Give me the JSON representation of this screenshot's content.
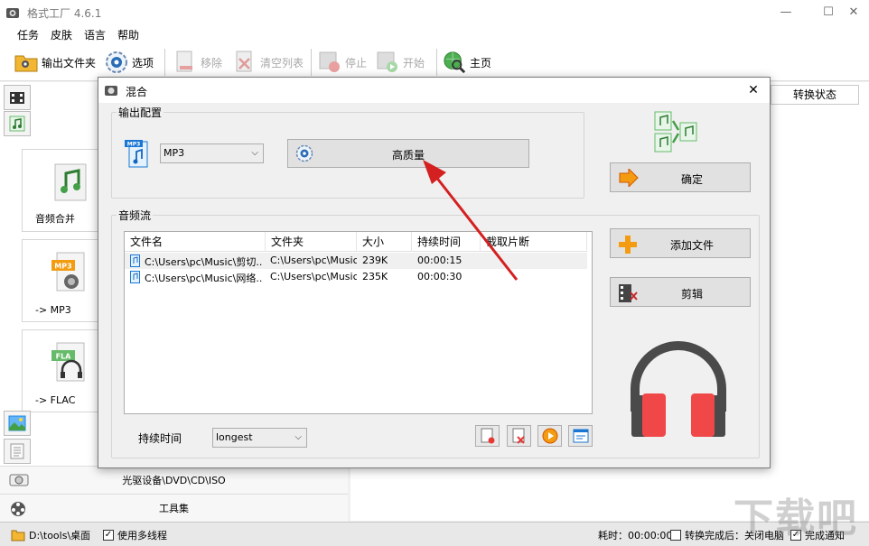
{
  "app": {
    "title": "格式工厂 4.6.1"
  },
  "window_controls": {
    "minimize": "—",
    "maximize": "☐",
    "close": "✕"
  },
  "menu": [
    "任务",
    "皮肤",
    "语言",
    "帮助"
  ],
  "toolbar": {
    "output_folder": "输出文件夹",
    "options": "选项",
    "remove": "移除",
    "clear_list": "清空列表",
    "stop": "停止",
    "start": "开始",
    "home": "主页"
  },
  "left_panel": {
    "tiles": [
      {
        "label": "音频合并",
        "badge": ""
      },
      {
        "label": "-> MP3",
        "badge": "MP3"
      },
      {
        "label": "-> FLAC",
        "badge": "FLA"
      }
    ],
    "categories": [
      "光驱设备\\DVD\\CD\\ISO",
      "工具集"
    ]
  },
  "right_panel": {
    "status_header": "转换状态"
  },
  "statusbar": {
    "path": "D:\\tools\\桌面",
    "multithread": "使用多线程",
    "elapsed": "耗时：00:00:00",
    "after_convert": "转换完成后：关闭电脑",
    "notify": "完成通知"
  },
  "dialog": {
    "title": "混合",
    "output_config_label": "输出配置",
    "format": {
      "value": "MP3",
      "icon_badge": "MP3"
    },
    "quality_button": "高质量",
    "ok_button": "确定",
    "audio_stream_label": "音频流",
    "add_file_button": "添加文件",
    "edit_button": "剪辑",
    "table": {
      "columns": [
        "文件名",
        "文件夹",
        "大小",
        "持续时间",
        "截取片断"
      ],
      "rows": [
        {
          "name": "C:\\Users\\pc\\Music\\剪切...",
          "folder": "C:\\Users\\pc\\Music",
          "size": "239K",
          "duration": "00:00:15",
          "clip": ""
        },
        {
          "name": "C:\\Users\\pc\\Music\\网络...",
          "folder": "C:\\Users\\pc\\Music",
          "size": "235K",
          "duration": "00:00:30",
          "clip": ""
        }
      ]
    },
    "duration_label": "持续时间",
    "duration_select": "longest"
  },
  "watermark": "下载吧",
  "colors": {
    "accent_red": "#d32f2f",
    "headphone_red": "#f04848",
    "headphone_dark": "#4a4a4a",
    "arrow_red": "#d42020"
  }
}
